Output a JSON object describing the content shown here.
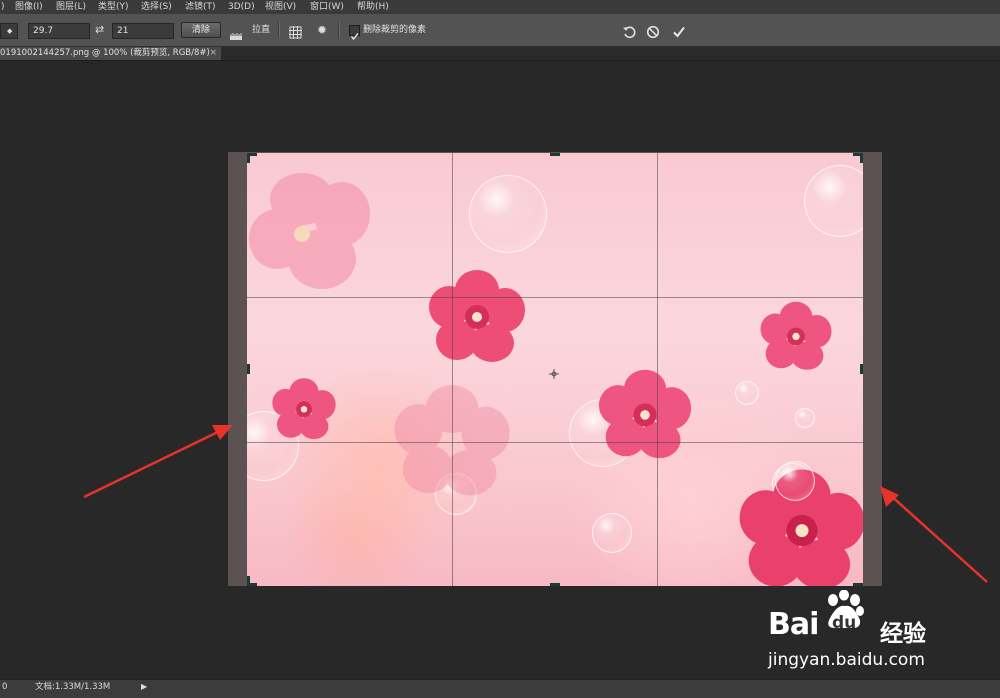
{
  "menubar": {
    "items": [
      "图像(I)",
      "图层(L)",
      "类型(Y)",
      "选择(S)",
      "滤镜(T)",
      "3D(D)",
      "视图(V)",
      "窗口(W)",
      "帮助(H)"
    ],
    "leading": ")"
  },
  "options": {
    "width_value": "29.7",
    "height_value": "21",
    "clear_label": "清除",
    "straighten_label": "拉直",
    "delete_cropped_label": "删除裁剪的像素",
    "delete_cropped_checked": true
  },
  "document_tab": {
    "title": "0191002144257.png @ 100% (裁剪预览, RGB/8#)",
    "close": "×"
  },
  "status": {
    "doc_info": "文档:1.33M/1.33M",
    "left_glyph": "0",
    "arrow": "▶"
  },
  "watermark": {
    "brand": "Bai",
    "brand2": "du",
    "suffix": "经验",
    "url": "jingyan.baidu.com"
  },
  "icons": {
    "stepper": "stepper-icon",
    "swap": "swap-icon",
    "straighten": "straighten-icon",
    "grid_overlay": "grid-overlay-icon",
    "settings": "gear-icon",
    "reset": "undo-icon",
    "cancel": "cancel-icon",
    "commit": "checkmark-icon"
  },
  "colors": {
    "annotation_arrow": "#e8322c",
    "canvas_bg": "#f9c9d2"
  }
}
